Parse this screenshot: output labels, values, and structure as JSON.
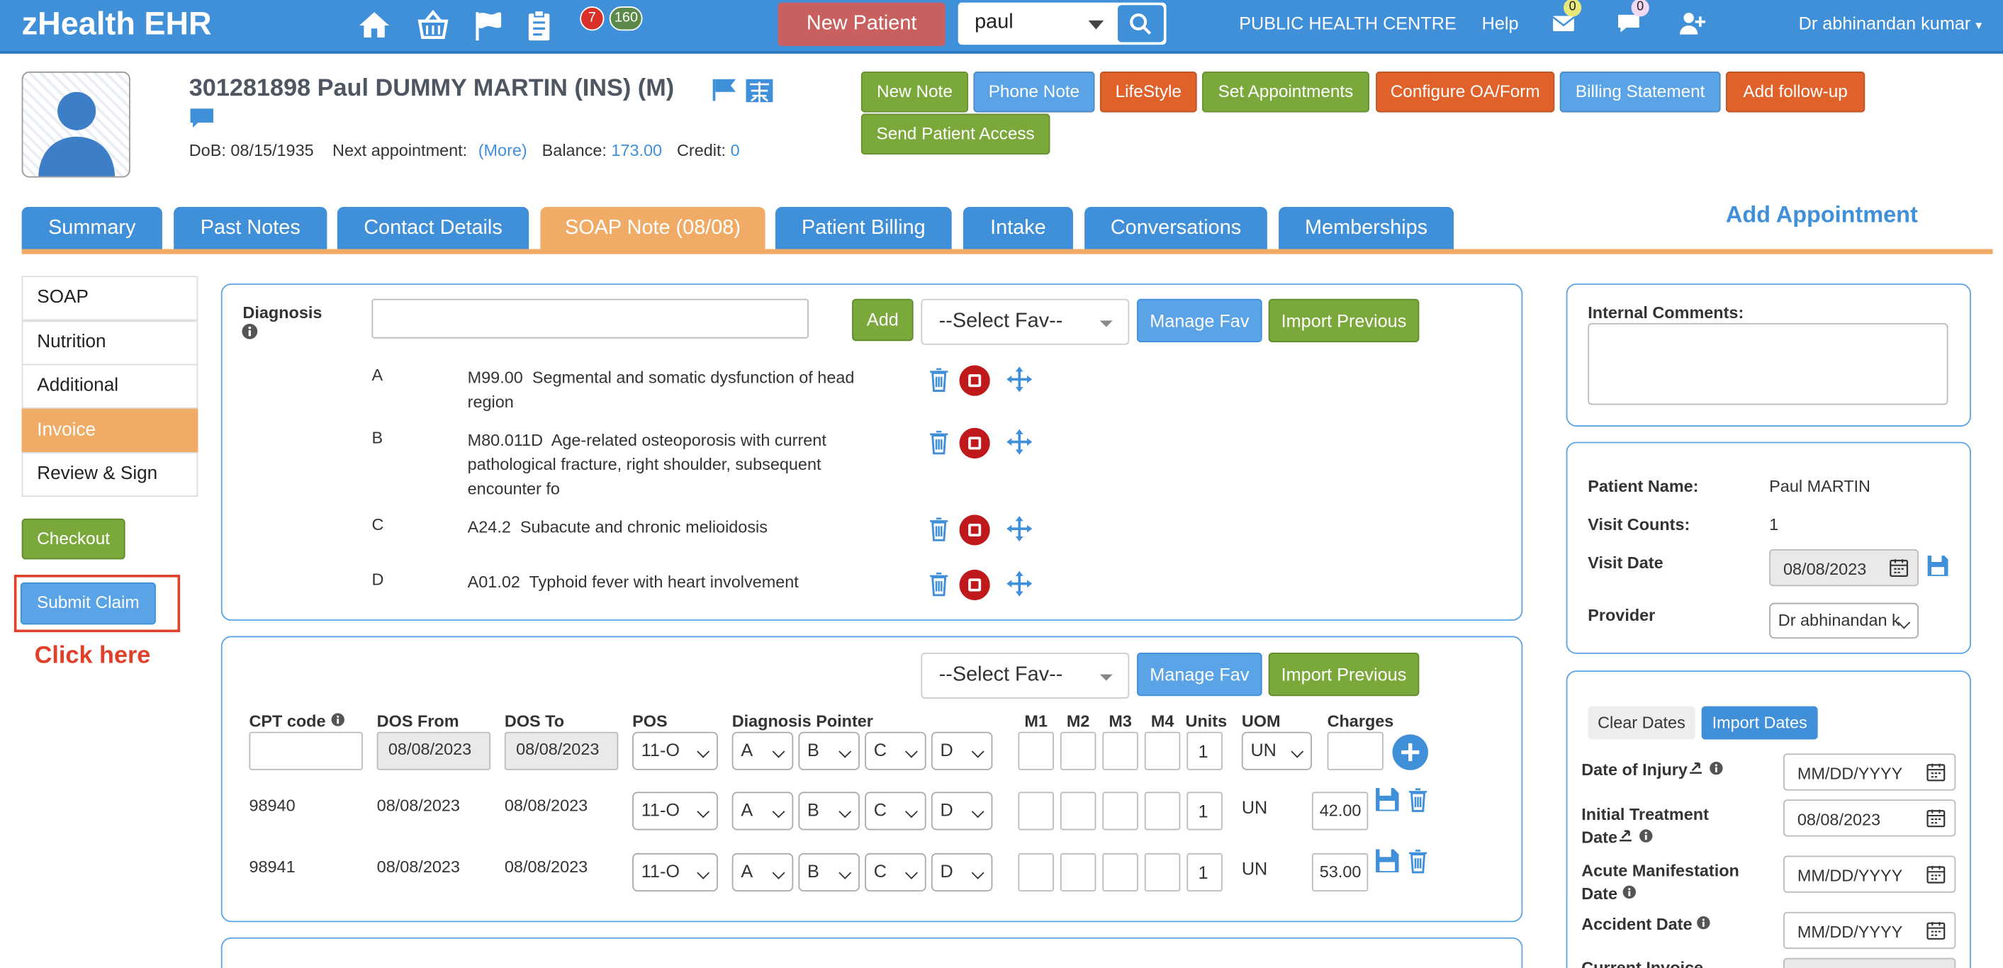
{
  "app": {
    "brand": "zHealth EHR",
    "new_patient": "New Patient",
    "search_value": "paul",
    "badge_red": "7",
    "badge_green": "160",
    "clinic": "PUBLIC HEALTH CENTRE",
    "help": "Help",
    "mail_count": "0",
    "chat_count": "0",
    "user": "Dr abhinandan kumar"
  },
  "patient": {
    "title": "301281898 Paul DUMMY MARTIN  (INS) (M)",
    "dob_label": "DoB:",
    "dob": "08/15/1935",
    "next_label": "Next appointment:",
    "next_link": "(More)",
    "balance_label": "Balance:",
    "balance": "173.00",
    "credit_label": "Credit:",
    "credit": "0"
  },
  "actions": [
    "New Note",
    "Phone Note",
    "LifeStyle",
    "Set Appointments",
    "Configure OA/Form",
    "Billing Statement",
    "Add follow-up",
    "Send Patient Access"
  ],
  "tabs": [
    "Summary",
    "Past Notes",
    "Contact Details",
    "SOAP Note (08/08)",
    "Patient Billing",
    "Intake",
    "Conversations",
    "Memberships"
  ],
  "add_appointment": "Add Appointment",
  "left_menu": [
    "SOAP",
    "Nutrition",
    "Additional",
    "Invoice",
    "Review & Sign"
  ],
  "checkout": "Checkout",
  "submit_claim": "Submit Claim",
  "click_here": "Click here",
  "diagnosis": {
    "label": "Diagnosis",
    "add": "Add",
    "select_fav": "--Select Fav--",
    "manage_fav": "Manage Fav",
    "import_previous": "Import Previous",
    "items": [
      {
        "letter": "A",
        "code": "M99.00",
        "desc1": "Segmental and somatic dysfunction of head",
        "desc2": "region",
        "desc3": ""
      },
      {
        "letter": "B",
        "code": "M80.011D",
        "desc1": "Age-related osteoporosis with current",
        "desc2": "pathological fracture, right shoulder, subsequent",
        "desc3": "encounter fo"
      },
      {
        "letter": "C",
        "code": "A24.2",
        "desc1": "Subacute and chronic melioidosis",
        "desc2": "",
        "desc3": ""
      },
      {
        "letter": "D",
        "code": "A01.02",
        "desc1": "Typhoid fever with heart involvement",
        "desc2": "",
        "desc3": ""
      }
    ]
  },
  "cpt": {
    "select_fav": "--Select Fav--",
    "manage_fav": "Manage Fav",
    "import_previous": "Import Previous",
    "headers": {
      "cpt": "CPT code",
      "dos_from": "DOS From",
      "dos_to": "DOS To",
      "pos": "POS",
      "pointer": "Diagnosis Pointer",
      "m1": "M1",
      "m2": "M2",
      "m3": "M3",
      "m4": "M4",
      "units": "Units",
      "uom": "UOM",
      "charges": "Charges"
    },
    "entry": {
      "dos_from": "08/08/2023",
      "dos_to": "08/08/2023",
      "pos": "11-O",
      "p1": "A",
      "p2": "B",
      "p3": "C",
      "p4": "D",
      "units": "1",
      "uom": "UN"
    },
    "rows": [
      {
        "code": "98940",
        "dos_from": "08/08/2023",
        "dos_to": "08/08/2023",
        "pos": "11-O",
        "p1": "A",
        "p2": "B",
        "p3": "C",
        "p4": "D",
        "units": "1",
        "uom": "UN",
        "charge": "42.00"
      },
      {
        "code": "98941",
        "dos_from": "08/08/2023",
        "dos_to": "08/08/2023",
        "pos": "11-O",
        "p1": "A",
        "p2": "B",
        "p3": "C",
        "p4": "D",
        "units": "1",
        "uom": "UN",
        "charge": "53.00"
      }
    ]
  },
  "right": {
    "internal_comments": "Internal Comments:",
    "patient_name_label": "Patient Name:",
    "patient_name": "Paul MARTIN",
    "visit_counts_label": "Visit Counts:",
    "visit_counts": "1",
    "visit_date_label": "Visit Date",
    "visit_date": "08/08/2023",
    "provider_label": "Provider",
    "provider": "Dr abhinandan k",
    "clear_dates": "Clear Dates",
    "import_dates": "Import Dates",
    "date_injury_label": "Date of Injury",
    "date_injury": "MM/DD/YYYY",
    "initial_label1": "Initial Treatment",
    "initial_label2": "Date",
    "initial_date": "08/08/2023",
    "acute_label1": "Acute Manifestation",
    "acute_label2": "Date",
    "acute_date": "MM/DD/YYYY",
    "accident_label": "Accident Date",
    "accident_date": "MM/DD/YYYY",
    "current_invoice": "Current Invoice"
  }
}
